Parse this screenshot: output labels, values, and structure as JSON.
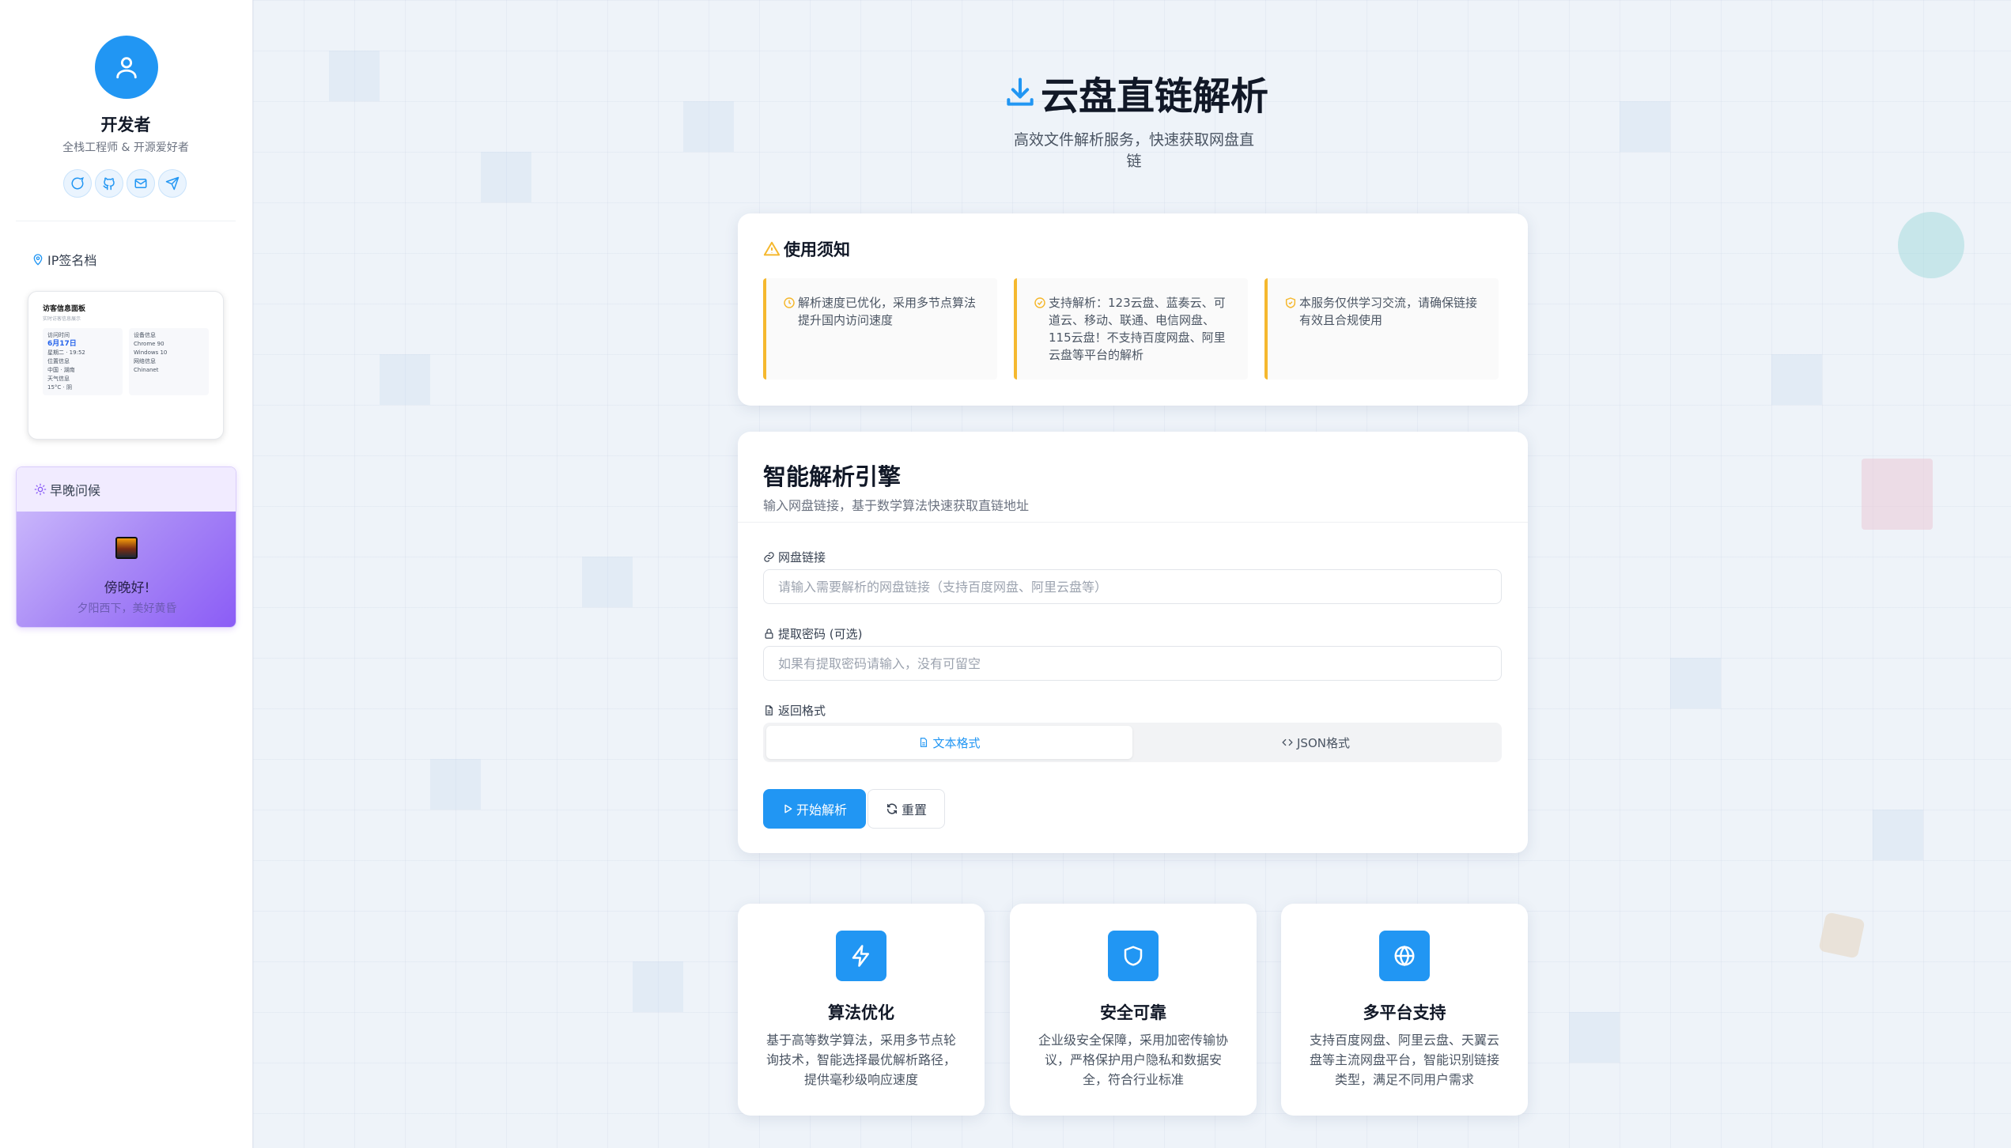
{
  "profile": {
    "name": "开发者",
    "bio": "全栈工程师 & 开源爱好者",
    "socials": [
      "message-icon",
      "github-icon",
      "mail-icon",
      "send-icon"
    ]
  },
  "ip_sign": {
    "title": "IP签名档",
    "card_title": "访客信息面板",
    "card_sub": "实时访客信息展示",
    "visit_label": "访问时间",
    "visit_date": "6月17日",
    "visit_weekday": "星期二 · 19:52",
    "location_label": "位置信息",
    "location_value": "中国 · 湖南",
    "weather_label": "天气信息",
    "weather_value": "15°C · 阴",
    "device_label": "设备信息",
    "device_browser": "Chrome 90",
    "device_os": "Windows 10",
    "network_label": "网络信息",
    "network_value": "Chinanet"
  },
  "greeting": {
    "title": "早晚问候",
    "text": "傍晚好!",
    "sub": "夕阳西下，美好黄昏"
  },
  "header": {
    "title": "云盘直链解析",
    "subtitle": "高效文件解析服务，快速获取网盘直链"
  },
  "notice": {
    "title": "使用须知",
    "items": [
      "解析速度已优化，采用多节点算法提升国内访问速度",
      "支持解析：123云盘、蓝奏云、可道云、移动、联通、电信网盘、115云盘！不支持百度网盘、阿里云盘等平台的解析",
      "本服务仅供学习交流，请确保链接有效且合规使用"
    ]
  },
  "engine": {
    "title": "智能解析引擎",
    "subtitle": "输入网盘链接，基于数学算法快速获取直链地址",
    "link_label": "网盘链接",
    "link_placeholder": "请输入需要解析的网盘链接（支持百度网盘、阿里云盘等）",
    "link_value": "",
    "pwd_label": "提取密码 (可选)",
    "pwd_placeholder": "如果有提取密码请输入，没有可留空",
    "pwd_value": "",
    "format_label": "返回格式",
    "format_text": "文本格式",
    "format_json": "JSON格式",
    "format_selected": "文本格式",
    "start_button": "开始解析",
    "reset_button": "重置"
  },
  "features": [
    {
      "icon": "lightning-icon",
      "title": "算法优化",
      "desc": "基于高等数学算法，采用多节点轮询技术，智能选择最优解析路径，提供毫秒级响应速度"
    },
    {
      "icon": "shield-icon",
      "title": "安全可靠",
      "desc": "企业级安全保障，采用加密传输协议，严格保护用户隐私和数据安全，符合行业标准"
    },
    {
      "icon": "globe-icon",
      "title": "多平台支持",
      "desc": "支持百度网盘、阿里云盘、天翼云盘等主流网盘平台，智能识别链接类型，满足不同用户需求"
    }
  ],
  "colors": {
    "accent": "#2196f3",
    "warning": "#f5b82e",
    "greeting_purple": "#8b5cf6"
  }
}
